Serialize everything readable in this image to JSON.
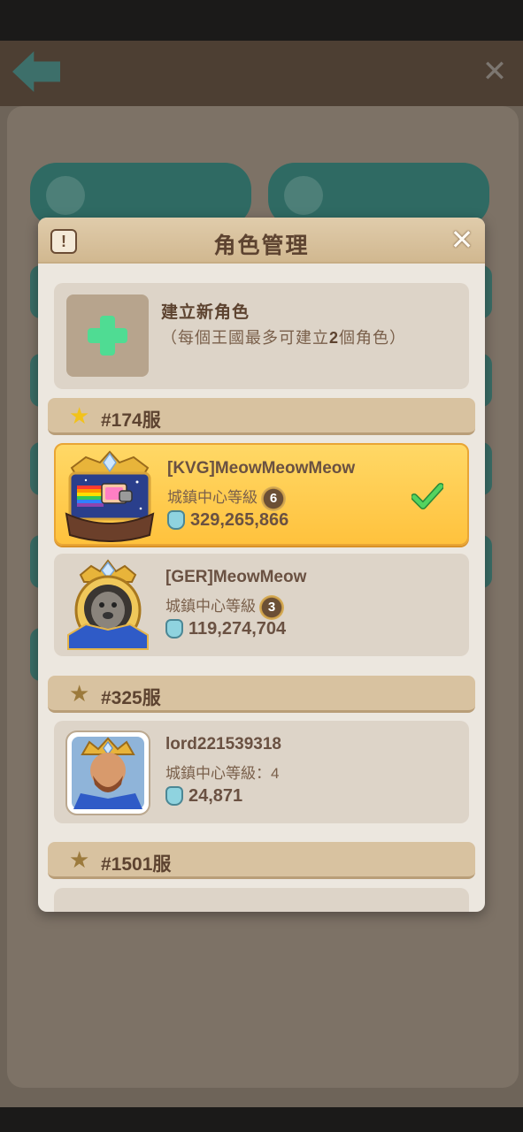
{
  "modal": {
    "title": "角色管理",
    "info_icon": "exclamation-icon",
    "close_icon": "close-icon"
  },
  "create": {
    "title": "建立新角色",
    "note_prefix": "（每個王國最多可建立",
    "note_count": "2",
    "note_suffix": "個角色）"
  },
  "servers": [
    {
      "label": "#174服",
      "star_color": "#f2c21b",
      "characters": [
        {
          "name": "[KVG]MeowMeowMeow",
          "level_label": "城鎮中心等級",
          "level": "6",
          "power": "329,265,866",
          "selected": true
        },
        {
          "name": "[GER]MeowMeow",
          "level_label": "城鎮中心等級",
          "level": "3",
          "power": "119,274,704",
          "selected": false
        }
      ]
    },
    {
      "label": "#325服",
      "star_color": "#9c7a3c",
      "characters": [
        {
          "name": "lord221539318",
          "level_label": "城鎮中心等級：4",
          "power": "24,871",
          "selected": false
        }
      ]
    },
    {
      "label": "#1501服",
      "star_color": "#9c7a3c",
      "characters": []
    }
  ],
  "colors": {
    "accent_green": "#4fdc93",
    "selected_gold": "#ffc23d",
    "text_brown": "#5d4330"
  }
}
